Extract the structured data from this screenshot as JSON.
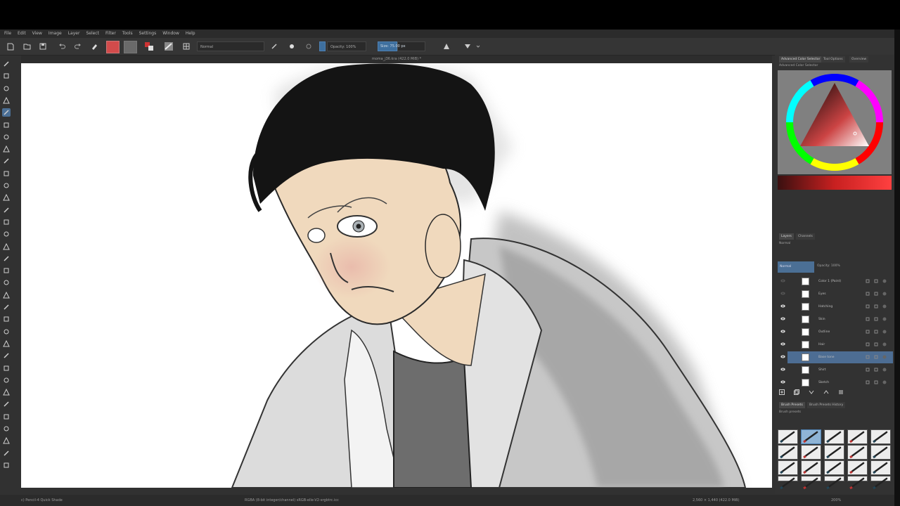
{
  "menu": [
    "File",
    "Edit",
    "View",
    "Image",
    "Layer",
    "Select",
    "Filter",
    "Tools",
    "Settings",
    "Window",
    "Help"
  ],
  "toolbar": {
    "blend_mode": "Normal",
    "opacity_label": "Opacity: 100%",
    "size_label": "Size: 75.00 px"
  },
  "document": {
    "title": "moma_j36.kra (422.0 MiB) *"
  },
  "docker": {
    "tabs": [
      "Advanced Color Selector",
      "Tool Options",
      "Overview"
    ],
    "color_selector_label": "Advanced Color Selector",
    "layer_tabs": [
      "Layers",
      "Channels"
    ],
    "blending_label": "Normal",
    "blend_mode_value": "Normal",
    "opacity_value": "Opacity: 100%",
    "layers": [
      {
        "name": "Color 1 (Paint)",
        "visible": false,
        "selected": false
      },
      {
        "name": "Eyes",
        "visible": false,
        "selected": false
      },
      {
        "name": "Hatching",
        "visible": true,
        "selected": false
      },
      {
        "name": "Skin",
        "visible": true,
        "selected": false
      },
      {
        "name": "Outline",
        "visible": true,
        "selected": false
      },
      {
        "name": "Hair",
        "visible": true,
        "selected": false
      },
      {
        "name": "Base tone",
        "visible": true,
        "selected": true
      },
      {
        "name": "Shirt",
        "visible": true,
        "selected": false
      },
      {
        "name": "Sketch",
        "visible": true,
        "selected": false
      }
    ],
    "brush_tabs": [
      "Brush Presets",
      "Brush Presets History"
    ],
    "brush_tag": "Brush presets"
  },
  "status": {
    "brush_name": "c) Pencil-4 Quick Shade",
    "color_info": "RGBA (8-bit integer/channel)  sRGB-elle-V2-srgbtrc.icc",
    "dimensions": "2,560 × 1,440 (422.0 MiB)",
    "zoom": "200%"
  },
  "colors": {
    "accent": "#4d80b2",
    "primary_color": "#d24b4b",
    "hair": "#141414",
    "skin": "#f0d9bd",
    "shirt": "#6d6d6d"
  }
}
